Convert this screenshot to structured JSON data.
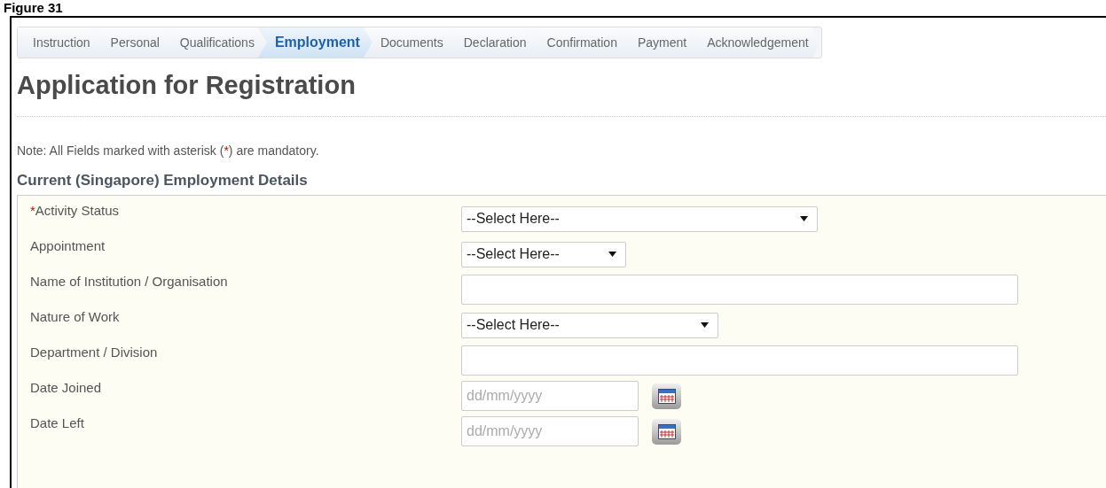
{
  "figure_label": "Figure 31",
  "steps": [
    {
      "label": "Instruction",
      "selected": false
    },
    {
      "label": "Personal",
      "selected": false
    },
    {
      "label": "Qualifications",
      "selected": false
    },
    {
      "label": "Employment",
      "selected": true
    },
    {
      "label": "Documents",
      "selected": false
    },
    {
      "label": "Declaration",
      "selected": false
    },
    {
      "label": "Confirmation",
      "selected": false
    },
    {
      "label": "Payment",
      "selected": false
    },
    {
      "label": "Acknowledgement",
      "selected": false
    }
  ],
  "title": "Application for Registration",
  "note": {
    "before": "Note: All Fields marked with asterisk (",
    "marker": "*",
    "after": ") are mandatory."
  },
  "section_title": "Current (Singapore) Employment Details",
  "fields": [
    {
      "label": "Activity Status",
      "marker": "*",
      "kind": "select",
      "value": "--Select Here--"
    },
    {
      "label": "Appointment",
      "kind": "select",
      "value": "--Select Here--"
    },
    {
      "label": "Name of Institution / Organisation",
      "kind": "text"
    },
    {
      "label": "Nature of Work",
      "kind": "select",
      "value": "--Select Here--"
    },
    {
      "label": "Department / Division",
      "kind": "text"
    },
    {
      "label": "Date Joined",
      "kind": "date",
      "placeholder": "dd/mm/yyyy"
    },
    {
      "label": "Date Left",
      "kind": "date",
      "placeholder": "dd/mm/yyyy"
    }
  ]
}
